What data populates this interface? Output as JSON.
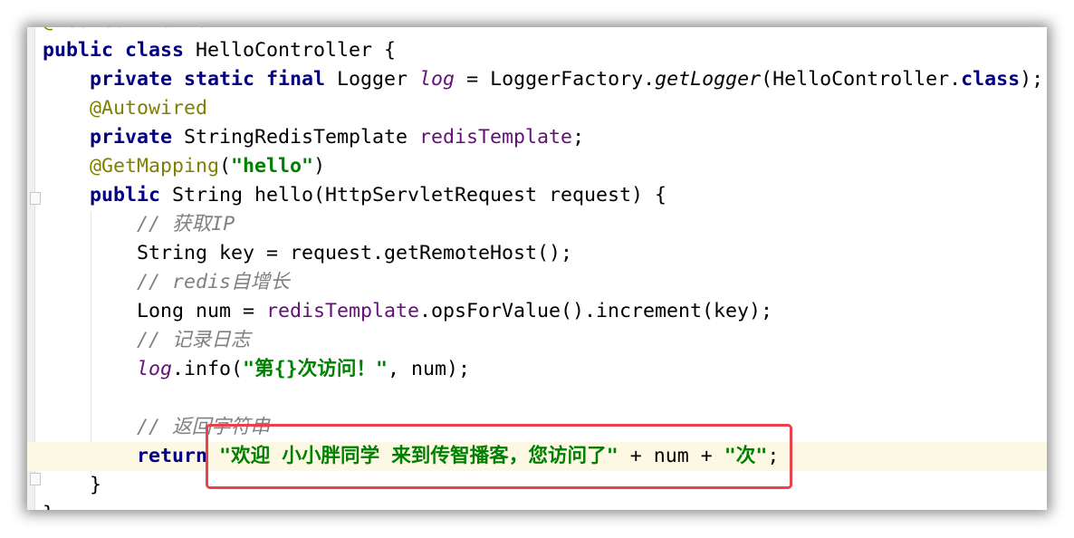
{
  "editor": {
    "lines": [
      [
        [
          "@RestController",
          "ann"
        ]
      ],
      [
        [
          "public class ",
          "kw"
        ],
        [
          "HelloController {",
          "plain"
        ]
      ],
      [
        [
          "    ",
          "plain"
        ],
        [
          "private static final ",
          "kw"
        ],
        [
          "Logger ",
          "plain"
        ],
        [
          "log",
          "sfld"
        ],
        [
          " = LoggerFactory.",
          "plain"
        ],
        [
          "getLogger",
          "it"
        ],
        [
          "(HelloController.",
          "plain"
        ],
        [
          "class",
          "kw"
        ],
        [
          ");",
          "plain"
        ]
      ],
      [
        [
          "    ",
          "plain"
        ],
        [
          "@Autowired",
          "ann"
        ]
      ],
      [
        [
          "    ",
          "plain"
        ],
        [
          "private ",
          "kw"
        ],
        [
          "StringRedisTemplate ",
          "plain"
        ],
        [
          "redisTemplate",
          "fld"
        ],
        [
          ";",
          "plain"
        ]
      ],
      [
        [
          "    ",
          "plain"
        ],
        [
          "@GetMapping",
          "ann"
        ],
        [
          "(",
          "plain"
        ],
        [
          "\"hello\"",
          "str"
        ],
        [
          ")",
          "plain"
        ]
      ],
      [
        [
          "    ",
          "plain"
        ],
        [
          "public ",
          "kw"
        ],
        [
          "String hello(HttpServletRequest request) {",
          "plain"
        ]
      ],
      [
        [
          "        ",
          "plain"
        ],
        [
          "// 获取IP",
          "cmt"
        ]
      ],
      [
        [
          "        ",
          "plain"
        ],
        [
          "String key = request.getRemoteHost();",
          "plain"
        ]
      ],
      [
        [
          "        ",
          "plain"
        ],
        [
          "// redis自增长",
          "cmt"
        ]
      ],
      [
        [
          "        ",
          "plain"
        ],
        [
          "Long num = ",
          "plain"
        ],
        [
          "redisTemplate",
          "fld"
        ],
        [
          ".opsForValue().increment(key);",
          "plain"
        ]
      ],
      [
        [
          "        ",
          "plain"
        ],
        [
          "// 记录日志",
          "cmt"
        ]
      ],
      [
        [
          "        ",
          "plain"
        ],
        [
          "log",
          "sfld"
        ],
        [
          ".info(",
          "plain"
        ],
        [
          "\"第{}次访问！\"",
          "str"
        ],
        [
          ", num);",
          "plain"
        ]
      ],
      [
        [
          "",
          "plain"
        ]
      ],
      [
        [
          "        ",
          "plain"
        ],
        [
          "// 返回字符串",
          "cmt"
        ]
      ],
      [
        [
          "        ",
          "plain"
        ],
        [
          "return ",
          "kw"
        ],
        [
          "\"欢迎 小小胖同学 来到传智播客，您访问了\"",
          "str"
        ],
        [
          " + num + ",
          "plain"
        ],
        [
          "\"次\"",
          "str"
        ],
        [
          ";",
          "plain"
        ]
      ],
      [
        [
          "    }",
          "plain"
        ]
      ],
      [
        [
          "}",
          "plain"
        ]
      ]
    ],
    "highlighted_line": 15,
    "colors": {
      "highlight_box": "#e8424a",
      "caret_line": "#fdf8e4",
      "keyword": "#000080",
      "string": "#008000",
      "annotation": "#808000",
      "field": "#660e7a",
      "comment": "#808080"
    },
    "icons": [
      "lightbulb-icon",
      "fold-icon"
    ]
  }
}
